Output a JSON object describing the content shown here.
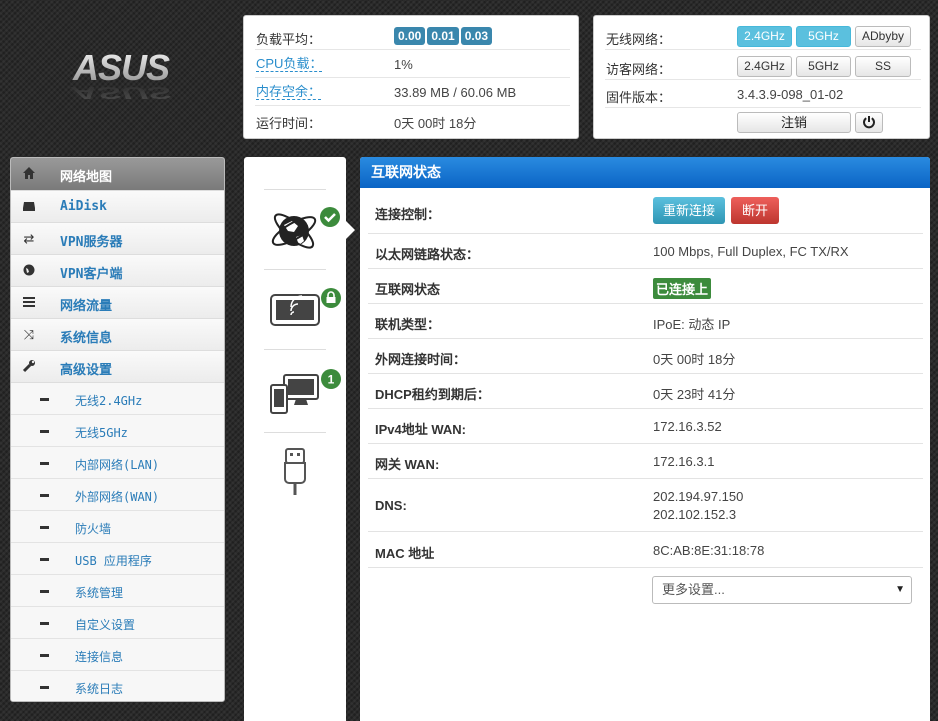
{
  "logo": {
    "text": "ASUS"
  },
  "status_panel": {
    "rows": [
      {
        "label": "负载平均：",
        "badges": [
          "0.00",
          "0.01",
          "0.03"
        ]
      },
      {
        "label": "CPU负载：",
        "value": "1%"
      },
      {
        "label": "内存空余：",
        "value": "33.89 MB / 60.06 MB"
      },
      {
        "label": "运行时间：",
        "value": "0天 00时 18分"
      }
    ]
  },
  "wireless_panel": {
    "wireless_label": "无线网络：",
    "wireless_buttons": [
      "2.4GHz",
      "5GHz",
      "ADbyby"
    ],
    "guest_label": "访客网络：",
    "guest_buttons": [
      "2.4GHz",
      "5GHz",
      "SS"
    ],
    "firmware_label": "固件版本：",
    "firmware_value": "3.4.3.9-098_01-02",
    "logout_label": "注销",
    "power_icon": "power-icon"
  },
  "menu": {
    "items": [
      {
        "label": "网络地图",
        "icon": "home-icon",
        "active": true
      },
      {
        "label": "AiDisk",
        "icon": "hdd-icon"
      },
      {
        "label": "VPN服务器",
        "icon": "retweet-icon"
      },
      {
        "label": "VPN客户端",
        "icon": "globe-icon"
      },
      {
        "label": "网络流量",
        "icon": "list-icon"
      },
      {
        "label": "系统信息",
        "icon": "random-icon"
      },
      {
        "label": "高级设置",
        "icon": "wrench-icon"
      }
    ],
    "sub_items": [
      "无线2.4GHz",
      "无线5GHz",
      "内部网络(LAN)",
      "外部网络(WAN)",
      "防火墙",
      "USB 应用程序",
      "系统管理",
      "自定义设置",
      "连接信息",
      "系统日志"
    ]
  },
  "map_icons": {
    "clients_count": "1"
  },
  "internet": {
    "title": "互联网状态",
    "control_label": "连接控制：",
    "reconnect_label": "重新连接",
    "disconnect_label": "断开",
    "rows": [
      {
        "key": "以太网链路状态：",
        "value": "100 Mbps, Full Duplex, FC TX/RX"
      },
      {
        "key": "互联网状态",
        "value": "已连接上"
      },
      {
        "key": "联机类型：",
        "value": "IPoE: 动态 IP"
      },
      {
        "key": "外网连接时间：",
        "value": "0天 00时 18分"
      },
      {
        "key": "DHCP租约到期后：",
        "value": "0天 23时 41分"
      },
      {
        "key": "IPv4地址 WAN:",
        "value": "172.16.3.52"
      },
      {
        "key": "网关 WAN:",
        "value": "172.16.3.1"
      },
      {
        "key": "DNS:",
        "value": "202.194.97.150",
        "value2": "202.102.152.3"
      },
      {
        "key": "MAC 地址",
        "value": "8C:AB:8E:31:18:78"
      }
    ],
    "more_settings": "更多设置..."
  },
  "colors": {
    "accent_blue": "#0a64c5",
    "link": "#2a8ecc",
    "ok_green": "#3c8b3c"
  }
}
